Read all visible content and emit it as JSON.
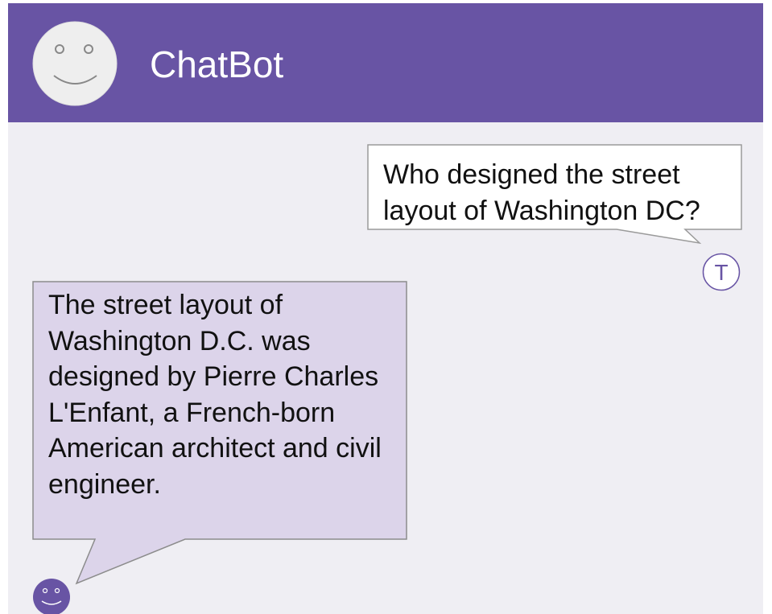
{
  "header": {
    "title": "ChatBot",
    "avatar_icon": "smiley-face-icon",
    "background_color": "#6854a4"
  },
  "messages": [
    {
      "sender": "user",
      "avatar_initial": "T",
      "text": "Who designed the street layout of Washington DC?",
      "bubble_color": "#ffffff"
    },
    {
      "sender": "bot",
      "avatar_icon": "smiley-face-icon",
      "text": "The street layout of Washington D.C. was designed by Pierre Charles L'Enfant, a French-born American architect and civil engineer.",
      "bubble_color": "#dcd4ea"
    }
  ],
  "colors": {
    "chat_background": "#efeef3",
    "accent": "#6854a4"
  }
}
